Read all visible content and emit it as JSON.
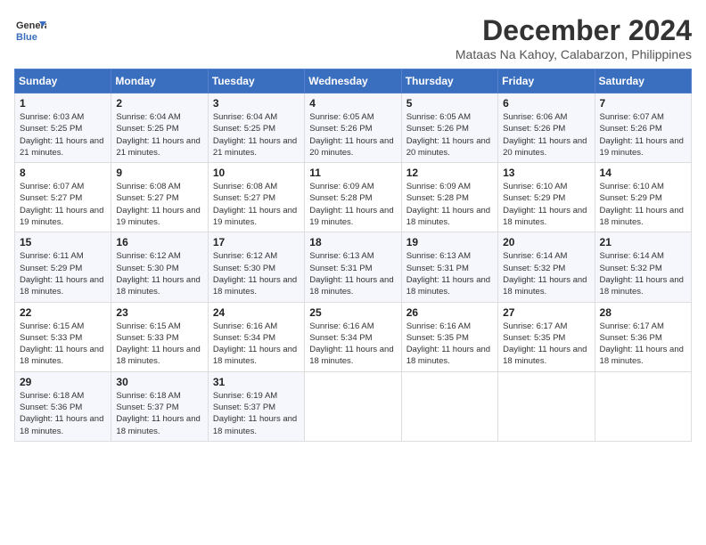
{
  "header": {
    "logo_line1": "General",
    "logo_line2": "Blue",
    "month": "December 2024",
    "location": "Mataas Na Kahoy, Calabarzon, Philippines"
  },
  "calendar": {
    "days_of_week": [
      "Sunday",
      "Monday",
      "Tuesday",
      "Wednesday",
      "Thursday",
      "Friday",
      "Saturday"
    ],
    "weeks": [
      [
        {
          "day": "1",
          "sunrise": "6:03 AM",
          "sunset": "5:25 PM",
          "daylight": "11 hours and 21 minutes."
        },
        {
          "day": "2",
          "sunrise": "6:04 AM",
          "sunset": "5:25 PM",
          "daylight": "11 hours and 21 minutes."
        },
        {
          "day": "3",
          "sunrise": "6:04 AM",
          "sunset": "5:25 PM",
          "daylight": "11 hours and 21 minutes."
        },
        {
          "day": "4",
          "sunrise": "6:05 AM",
          "sunset": "5:26 PM",
          "daylight": "11 hours and 20 minutes."
        },
        {
          "day": "5",
          "sunrise": "6:05 AM",
          "sunset": "5:26 PM",
          "daylight": "11 hours and 20 minutes."
        },
        {
          "day": "6",
          "sunrise": "6:06 AM",
          "sunset": "5:26 PM",
          "daylight": "11 hours and 20 minutes."
        },
        {
          "day": "7",
          "sunrise": "6:07 AM",
          "sunset": "5:26 PM",
          "daylight": "11 hours and 19 minutes."
        }
      ],
      [
        {
          "day": "8",
          "sunrise": "6:07 AM",
          "sunset": "5:27 PM",
          "daylight": "11 hours and 19 minutes."
        },
        {
          "day": "9",
          "sunrise": "6:08 AM",
          "sunset": "5:27 PM",
          "daylight": "11 hours and 19 minutes."
        },
        {
          "day": "10",
          "sunrise": "6:08 AM",
          "sunset": "5:27 PM",
          "daylight": "11 hours and 19 minutes."
        },
        {
          "day": "11",
          "sunrise": "6:09 AM",
          "sunset": "5:28 PM",
          "daylight": "11 hours and 19 minutes."
        },
        {
          "day": "12",
          "sunrise": "6:09 AM",
          "sunset": "5:28 PM",
          "daylight": "11 hours and 18 minutes."
        },
        {
          "day": "13",
          "sunrise": "6:10 AM",
          "sunset": "5:29 PM",
          "daylight": "11 hours and 18 minutes."
        },
        {
          "day": "14",
          "sunrise": "6:10 AM",
          "sunset": "5:29 PM",
          "daylight": "11 hours and 18 minutes."
        }
      ],
      [
        {
          "day": "15",
          "sunrise": "6:11 AM",
          "sunset": "5:29 PM",
          "daylight": "11 hours and 18 minutes."
        },
        {
          "day": "16",
          "sunrise": "6:12 AM",
          "sunset": "5:30 PM",
          "daylight": "11 hours and 18 minutes."
        },
        {
          "day": "17",
          "sunrise": "6:12 AM",
          "sunset": "5:30 PM",
          "daylight": "11 hours and 18 minutes."
        },
        {
          "day": "18",
          "sunrise": "6:13 AM",
          "sunset": "5:31 PM",
          "daylight": "11 hours and 18 minutes."
        },
        {
          "day": "19",
          "sunrise": "6:13 AM",
          "sunset": "5:31 PM",
          "daylight": "11 hours and 18 minutes."
        },
        {
          "day": "20",
          "sunrise": "6:14 AM",
          "sunset": "5:32 PM",
          "daylight": "11 hours and 18 minutes."
        },
        {
          "day": "21",
          "sunrise": "6:14 AM",
          "sunset": "5:32 PM",
          "daylight": "11 hours and 18 minutes."
        }
      ],
      [
        {
          "day": "22",
          "sunrise": "6:15 AM",
          "sunset": "5:33 PM",
          "daylight": "11 hours and 18 minutes."
        },
        {
          "day": "23",
          "sunrise": "6:15 AM",
          "sunset": "5:33 PM",
          "daylight": "11 hours and 18 minutes."
        },
        {
          "day": "24",
          "sunrise": "6:16 AM",
          "sunset": "5:34 PM",
          "daylight": "11 hours and 18 minutes."
        },
        {
          "day": "25",
          "sunrise": "6:16 AM",
          "sunset": "5:34 PM",
          "daylight": "11 hours and 18 minutes."
        },
        {
          "day": "26",
          "sunrise": "6:16 AM",
          "sunset": "5:35 PM",
          "daylight": "11 hours and 18 minutes."
        },
        {
          "day": "27",
          "sunrise": "6:17 AM",
          "sunset": "5:35 PM",
          "daylight": "11 hours and 18 minutes."
        },
        {
          "day": "28",
          "sunrise": "6:17 AM",
          "sunset": "5:36 PM",
          "daylight": "11 hours and 18 minutes."
        }
      ],
      [
        {
          "day": "29",
          "sunrise": "6:18 AM",
          "sunset": "5:36 PM",
          "daylight": "11 hours and 18 minutes."
        },
        {
          "day": "30",
          "sunrise": "6:18 AM",
          "sunset": "5:37 PM",
          "daylight": "11 hours and 18 minutes."
        },
        {
          "day": "31",
          "sunrise": "6:19 AM",
          "sunset": "5:37 PM",
          "daylight": "11 hours and 18 minutes."
        },
        null,
        null,
        null,
        null
      ]
    ]
  }
}
